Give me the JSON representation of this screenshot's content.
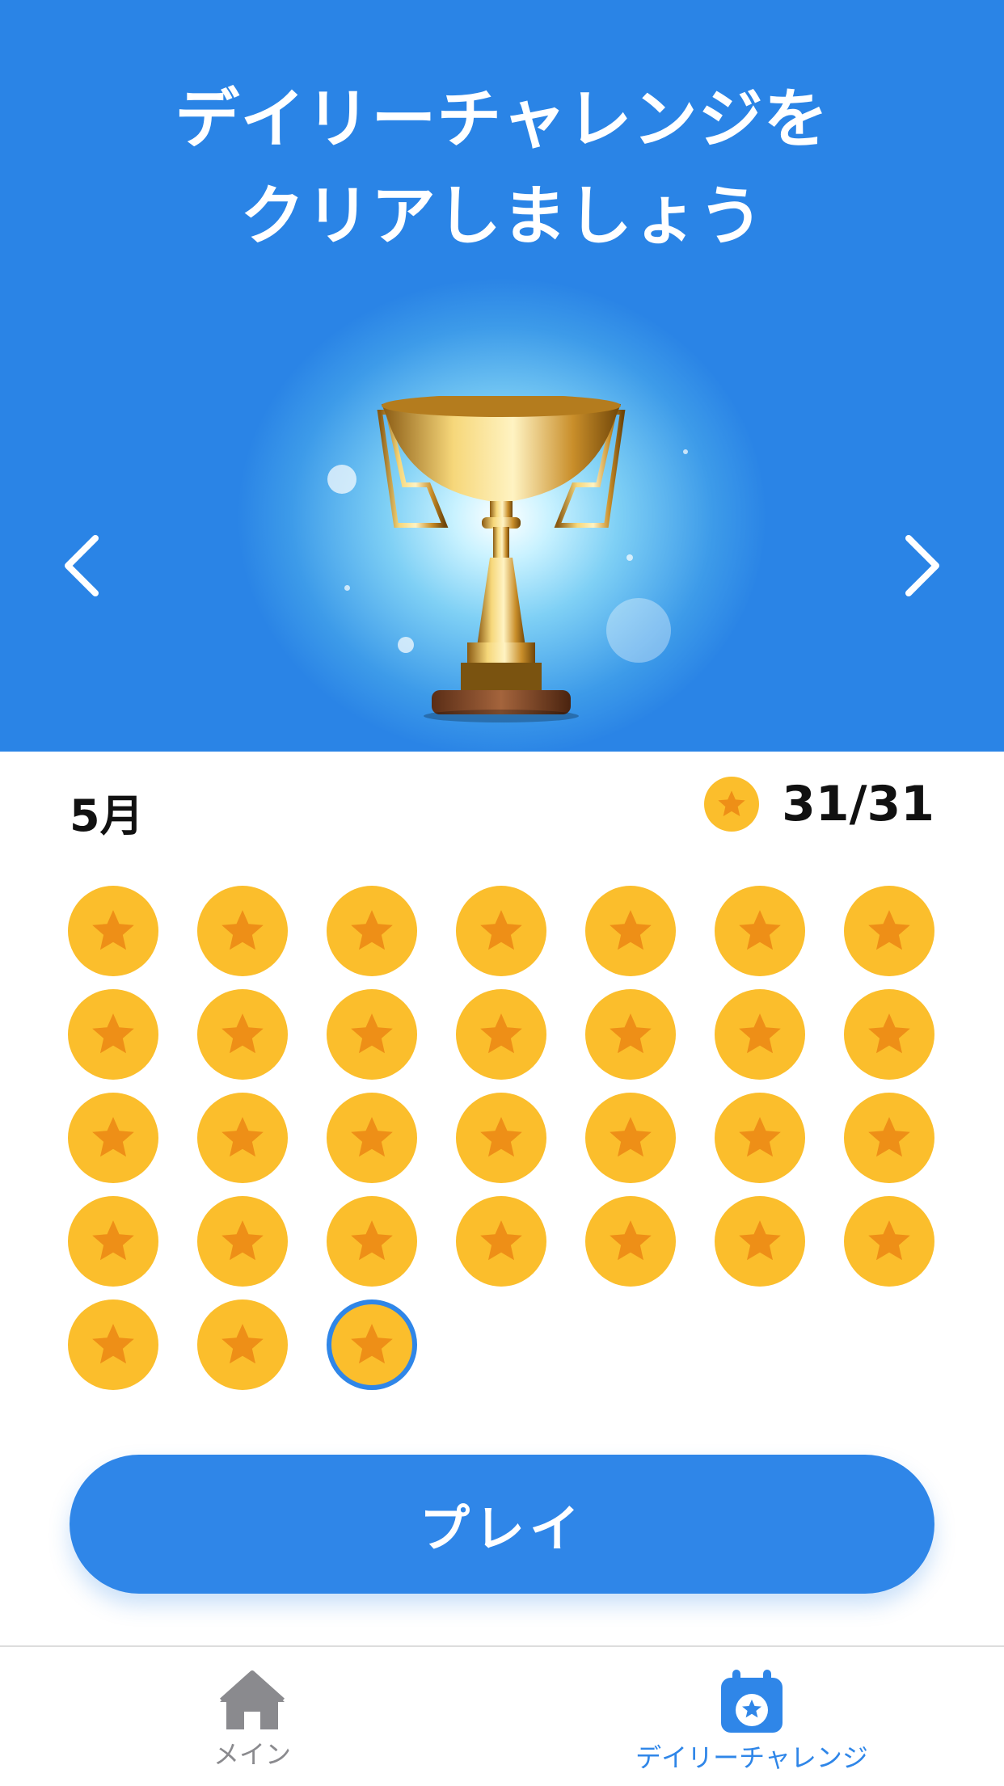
{
  "hero": {
    "title_line1": "デイリーチャレンジを",
    "title_line2": "クリアしましょう"
  },
  "icons": {
    "prev": "chevron-left-icon",
    "next": "chevron-right-icon",
    "trophy": "trophy-icon",
    "coin": "star-coin-icon",
    "home": "home-icon",
    "calendar": "calendar-star-icon"
  },
  "month": {
    "label": "5月",
    "progress_text": "31/31",
    "completed_days": 31,
    "total_days": 31,
    "selected_day": 31
  },
  "play_button": {
    "label": "プレイ"
  },
  "tabbar": {
    "tabs": [
      {
        "label": "メイン",
        "active": false
      },
      {
        "label": "デイリーチャレンジ",
        "active": true
      }
    ]
  },
  "colors": {
    "primary_blue": "#2f86e8",
    "coin_yellow": "#fbbe2c",
    "coin_star": "#ee8f17",
    "inactive_gray": "#8a8a8e"
  }
}
